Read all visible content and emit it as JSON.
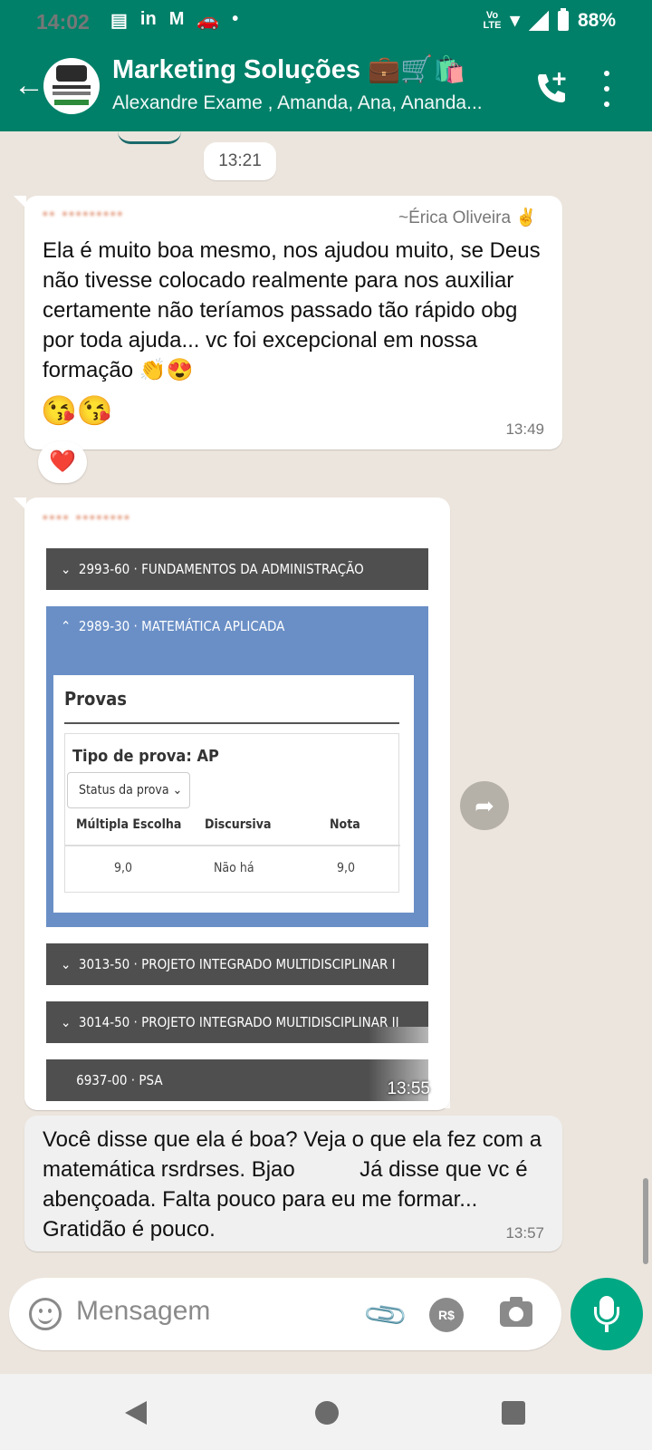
{
  "status_bar": {
    "time": "14:02",
    "network": "Vo LTE",
    "battery": "88%"
  },
  "header": {
    "title": "Marketing Soluções 💼🛒🛍️",
    "subtitle": "Alexandre Exame , Amanda, Ana, Ananda..."
  },
  "chat": {
    "date_chip": "13:21",
    "messages": [
      {
        "author": "~Érica Oliveira ✌️",
        "text": "Ela é  muito boa mesmo, nos  ajudou  muito, se Deus não  tivesse colocado realmente para nos  auxiliar  certamente não  teríamos passado tão  rápido obg por toda ajuda... vc foi excepcional em nossa formação 👏😍",
        "emojis": "😘😘",
        "time": "13:49",
        "reaction": "❤️"
      },
      {
        "time": "13:55",
        "image": {
          "accordion_1": "2993-60 · FUNDAMENTOS DA ADMINISTRAÇÃO",
          "accordion_2": "2989-30 · MATEMÁTICA APLICADA",
          "panel_title": "Provas",
          "tipo_label": "Tipo de prova: AP",
          "status_select": "Status da prova",
          "col_1": "Múltipla Escolha",
          "col_2": "Discursiva",
          "col_3": "Nota",
          "val_1": "9,0",
          "val_2": "Não há",
          "val_3": "9,0",
          "accordion_3": "3013-50 · PROJETO INTEGRADO MULTIDISCIPLINAR I",
          "accordion_4": "3014-50 · PROJETO INTEGRADO MULTIDISCIPLINAR II",
          "accordion_5": "6937-00 · PSA"
        }
      },
      {
        "text_a": "Você disse que ela é boa? Veja o que ela fez com a matemática rsrdrses. Bjao",
        "text_b": "Já disse que vc é abençoada. Falta pouco para eu me formar... Gratidão é pouco.",
        "time": "13:57"
      }
    ]
  },
  "composer": {
    "placeholder": "Mensagem",
    "currency_label": "R$"
  }
}
